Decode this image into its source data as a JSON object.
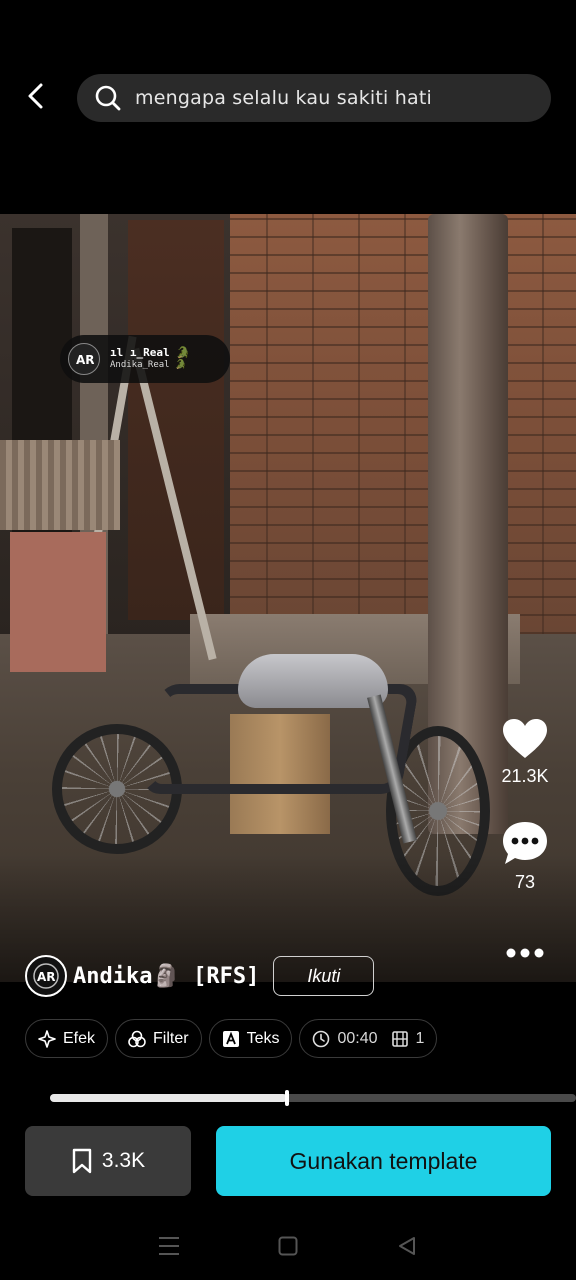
{
  "search": {
    "query": "mengapa selalu kau sakiti hati"
  },
  "watermark": {
    "line1": "ıl ı_Real 🐊",
    "line2": "Andika_Real 🐊"
  },
  "rail": {
    "likes": "21.3K",
    "comments": "73"
  },
  "author": {
    "name": "Andika🗿 [RFS]",
    "follow_label": "Ikuti"
  },
  "chips": {
    "effect": "Efek",
    "filter": "Filter",
    "text": "Teks",
    "duration": "00:40",
    "clips": "1"
  },
  "progress": {
    "fraction": 0.45
  },
  "buttons": {
    "save_count": "3.3K",
    "use_template": "Gunakan template"
  },
  "colors": {
    "accent": "#1fd0e6",
    "background": "#000000",
    "chip_border": "#3a3a3a"
  },
  "icons": [
    "back-arrow-icon",
    "search-icon",
    "heart-icon",
    "comment-icon",
    "more-icon",
    "effect-icon",
    "filter-icon",
    "text-icon",
    "clock-icon",
    "clips-icon",
    "bookmark-icon",
    "menu-icon",
    "home-icon",
    "back-triangle-icon"
  ]
}
